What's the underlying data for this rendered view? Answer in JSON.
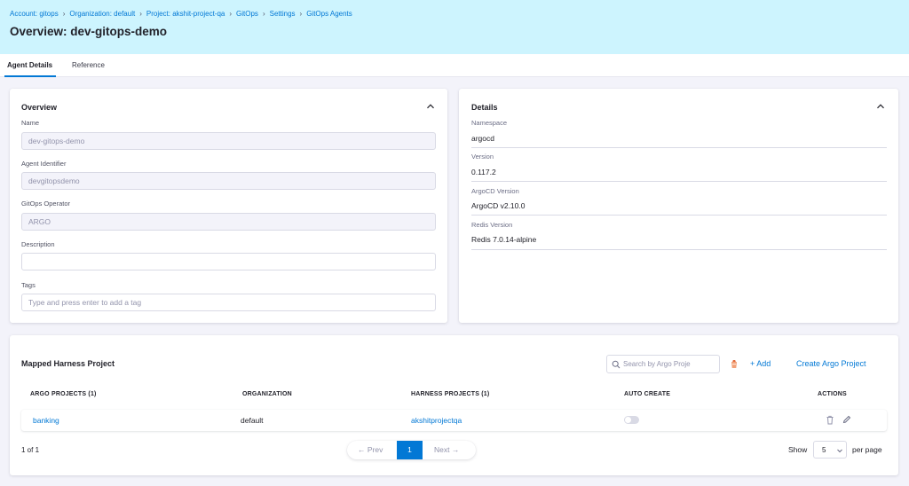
{
  "breadcrumb": [
    {
      "label": "Account: gitops"
    },
    {
      "label": "Organization: default"
    },
    {
      "label": "Project: akshit-project-qa"
    },
    {
      "label": "GitOps"
    },
    {
      "label": "Settings"
    },
    {
      "label": "GitOps Agents"
    }
  ],
  "page_title": "Overview: dev-gitops-demo",
  "tabs": [
    {
      "label": "Agent Details",
      "active": true
    },
    {
      "label": "Reference",
      "active": false
    }
  ],
  "overview": {
    "title": "Overview",
    "fields": [
      {
        "label": "Name",
        "value": "dev-gitops-demo",
        "disabled": true
      },
      {
        "label": "Agent Identifier",
        "value": "devgitopsdemo",
        "disabled": true
      },
      {
        "label": "GitOps Operator",
        "value": "ARGO",
        "disabled": true
      },
      {
        "label": "Description",
        "value": "",
        "disabled": false
      },
      {
        "label": "Tags",
        "placeholder": "Type and press enter to add a tag"
      }
    ]
  },
  "details": {
    "title": "Details",
    "items": [
      {
        "label": "Namespace",
        "value": "argocd"
      },
      {
        "label": "Version",
        "value": "0.117.2"
      },
      {
        "label": "ArgoCD Version",
        "value": "ArgoCD v2.10.0"
      },
      {
        "label": "Redis Version",
        "value": "Redis 7.0.14-alpine"
      }
    ]
  },
  "mapped": {
    "title": "Mapped Harness Project",
    "search_placeholder": "Search by Argo Proje",
    "add_label": "+ Add",
    "create_label": "Create Argo Project",
    "columns": [
      "ARGO PROJECTS (1)",
      "ORGANIZATION",
      "HARNESS PROJECTS (1)",
      "AUTO CREATE",
      "ACTIONS"
    ],
    "rows": [
      {
        "argo_project": "banking",
        "organization": "default",
        "harness_project": "akshitprojectqa",
        "auto_create": false
      }
    ]
  },
  "pagination": {
    "info": "1 of 1",
    "prev": "Prev",
    "current": "1",
    "next": "Next",
    "show_label": "Show",
    "page_size": "5",
    "per_page_label": "per page"
  },
  "colors": {
    "accent": "#0278d5",
    "header_bg": "#cdf4fe",
    "page_bg": "#f3f3fa"
  }
}
